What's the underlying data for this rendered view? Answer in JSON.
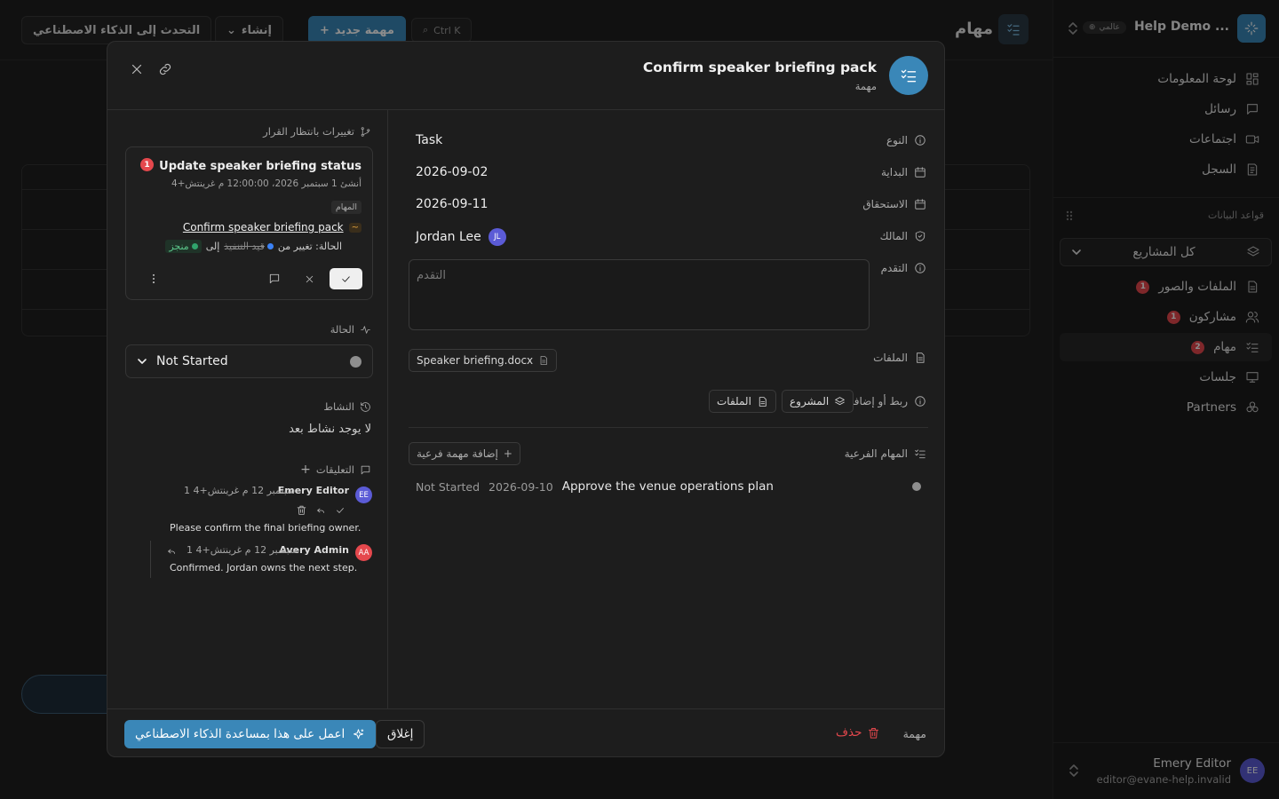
{
  "sidebar": {
    "workspace_name": "Help Demo ...",
    "workspace_badge": "عالمي",
    "nav": [
      {
        "label": "لوحة المعلومات",
        "icon": "dashboard-icon"
      },
      {
        "label": "رسائل",
        "icon": "message-icon"
      },
      {
        "label": "اجتماعات",
        "icon": "video-icon"
      },
      {
        "label": "السجل",
        "icon": "log-icon"
      }
    ],
    "databases_label": "قواعد البيانات",
    "project_select": "كل المشاريع",
    "db_items": [
      {
        "label": "الملفات والصور",
        "badge": "1"
      },
      {
        "label": "مشاركون",
        "badge": "1"
      },
      {
        "label": "مهام",
        "badge": "2"
      },
      {
        "label": "جلسات",
        "badge": ""
      },
      {
        "label": "Partners",
        "badge": ""
      }
    ],
    "user": {
      "name": "Emery Editor",
      "email": "editor@evane-help.invalid",
      "initials": "EE"
    }
  },
  "background": {
    "title": "مهام",
    "btn_new": "مهمة جديد",
    "btn_create": "إنشاء",
    "btn_ai": "التحدث إلى الذكاء الاصطناعي",
    "shortcut": "Ctrl K"
  },
  "modal": {
    "title": "Confirm speaker briefing pack",
    "subtitle": "مهمة",
    "fields": {
      "type_label": "النوع",
      "type_value": "Task",
      "start_label": "البداية",
      "start_value": "2026-09-02",
      "due_label": "الاستحقاق",
      "due_value": "2026-09-11",
      "owner_label": "المالك",
      "owner_value": "Jordan Lee",
      "owner_initials": "JL",
      "progress_label": "التقدم",
      "progress_placeholder": "التقدم",
      "files_label": "الملفات",
      "file_name": "Speaker briefing.docx",
      "link_label": "ربط أو إضافة",
      "link_project": "المشروع",
      "link_files": "الملفات"
    },
    "subtasks": {
      "label": "المهام الفرعية",
      "add_label": "إضافة مهمة فرعية",
      "items": [
        {
          "title": "Approve the venue operations plan",
          "date": "2026-09-10",
          "status": "Not Started"
        }
      ]
    },
    "pending": {
      "label": "تغييرات بانتظار القرار",
      "title": "Update speaker briefing status",
      "badge": "1",
      "date": "أنشئ 1 سبتمبر 2026، 12:00:00 م غرينتش+4",
      "tag": "المهام",
      "link": "Confirm speaker briefing pack",
      "change_prefix": "الحالة: تغيير من",
      "from": "قيد التنفيذ",
      "to_word": "إلى",
      "to": "منجز"
    },
    "status": {
      "label": "الحالة",
      "value": "Not Started"
    },
    "activity": {
      "label": "النشاط",
      "empty": "لا يوجد نشاط بعد"
    },
    "comments": {
      "label": "التعليقات",
      "items": [
        {
          "author": "Emery Editor",
          "initials": "EE",
          "time": "1 سبتمبر 12 م غرينتش+4",
          "text": "Please confirm the final briefing owner."
        },
        {
          "author": "Avery Admin",
          "initials": "AA",
          "time": "1 سبتمبر 12 م غرينتش+4",
          "text": "Confirmed. Jordan owns the next step."
        }
      ]
    },
    "footer": {
      "ai": "اعمل على هذا بمساعدة الذكاء الاصطناعي",
      "close": "إغلاق",
      "delete": "حذف",
      "type": "مهمة"
    }
  }
}
